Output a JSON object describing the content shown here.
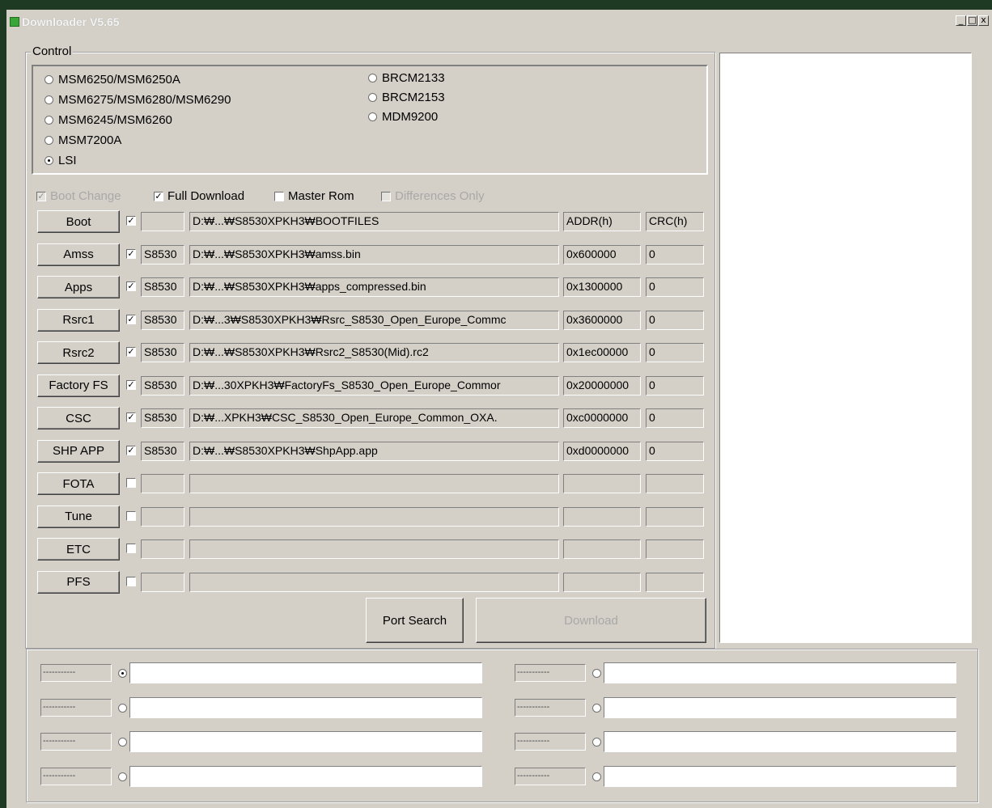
{
  "window": {
    "title": "Downloader V5.65",
    "controls": [
      "_",
      "□",
      "x"
    ]
  },
  "control": {
    "label": "Control",
    "chipsets_left": [
      {
        "label": "MSM6250/MSM6250A",
        "selected": false
      },
      {
        "label": "MSM6275/MSM6280/MSM6290",
        "selected": false
      },
      {
        "label": "MSM6245/MSM6260",
        "selected": false
      },
      {
        "label": "MSM7200A",
        "selected": false
      },
      {
        "label": "LSI",
        "selected": true
      }
    ],
    "chipsets_right": [
      {
        "label": "BRCM2133",
        "selected": false
      },
      {
        "label": "BRCM2153",
        "selected": false
      },
      {
        "label": "MDM9200",
        "selected": false
      }
    ]
  },
  "options": {
    "boot_change": {
      "label": "Boot Change",
      "checked": true,
      "disabled": true
    },
    "full_download": {
      "label": "Full Download",
      "checked": true,
      "disabled": false
    },
    "master_rom": {
      "label": "Master Rom",
      "checked": false,
      "disabled": false
    },
    "differences_only": {
      "label": "Differences Only",
      "checked": false,
      "disabled": true
    }
  },
  "check_mark": "✓",
  "rows": [
    {
      "button": "Boot",
      "checked": true,
      "model": "",
      "path": "D:₩...₩S8530XPKH3₩BOOTFILES",
      "addr": "ADDR(h)",
      "crc": "CRC(h)"
    },
    {
      "button": "Amss",
      "checked": true,
      "model": "S8530",
      "path": "D:₩...₩S8530XPKH3₩amss.bin",
      "addr": "0x600000",
      "crc": "0"
    },
    {
      "button": "Apps",
      "checked": true,
      "model": "S8530",
      "path": "D:₩...₩S8530XPKH3₩apps_compressed.bin",
      "addr": "0x1300000",
      "crc": "0"
    },
    {
      "button": "Rsrc1",
      "checked": true,
      "model": "S8530",
      "path": "D:₩...3₩S8530XPKH3₩Rsrc_S8530_Open_Europe_Commc",
      "addr": "0x3600000",
      "crc": "0"
    },
    {
      "button": "Rsrc2",
      "checked": true,
      "model": "S8530",
      "path": "D:₩...₩S8530XPKH3₩Rsrc2_S8530(Mid).rc2",
      "addr": "0x1ec00000",
      "crc": "0"
    },
    {
      "button": "Factory FS",
      "checked": true,
      "model": "S8530",
      "path": "D:₩...30XPKH3₩FactoryFs_S8530_Open_Europe_Commor",
      "addr": "0x20000000",
      "crc": "0"
    },
    {
      "button": "CSC",
      "checked": true,
      "model": "S8530",
      "path": "D:₩...XPKH3₩CSC_S8530_Open_Europe_Common_OXA.",
      "addr": "0xc0000000",
      "crc": "0"
    },
    {
      "button": "SHP APP",
      "checked": true,
      "model": "S8530",
      "path": "D:₩...₩S8530XPKH3₩ShpApp.app",
      "addr": "0xd0000000",
      "crc": "0"
    },
    {
      "button": "FOTA",
      "checked": false,
      "model": "",
      "path": "",
      "addr": "",
      "crc": ""
    },
    {
      "button": "Tune",
      "checked": false,
      "model": "",
      "path": "",
      "addr": "",
      "crc": ""
    },
    {
      "button": "ETC",
      "checked": false,
      "model": "",
      "path": "",
      "addr": "",
      "crc": ""
    },
    {
      "button": "PFS",
      "checked": false,
      "model": "",
      "path": "",
      "addr": "",
      "crc": ""
    }
  ],
  "actions": {
    "port_search": "Port Search",
    "download": "Download"
  },
  "ports": {
    "left": [
      {
        "label": "-----------",
        "selected": true,
        "value": ""
      },
      {
        "label": "-----------",
        "selected": false,
        "value": ""
      },
      {
        "label": "-----------",
        "selected": false,
        "value": ""
      },
      {
        "label": "-----------",
        "selected": false,
        "value": ""
      }
    ],
    "right": [
      {
        "label": "-----------",
        "selected": false,
        "value": ""
      },
      {
        "label": "-----------",
        "selected": false,
        "value": ""
      },
      {
        "label": "-----------",
        "selected": false,
        "value": ""
      },
      {
        "label": "-----------",
        "selected": false,
        "value": ""
      }
    ]
  }
}
